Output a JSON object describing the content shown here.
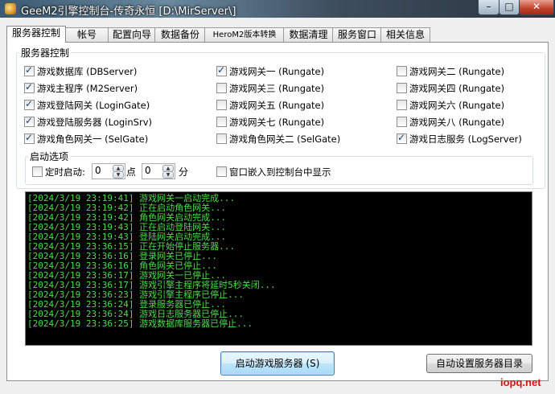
{
  "window": {
    "title": "GeeM2引擎控制台-传奇永恒 [D:\\MirServer\\]",
    "minimize": "–",
    "maximize": "□",
    "close": "✕"
  },
  "tabs": [
    "服务器控制",
    "帐号",
    "配置向导",
    "数据备份",
    "HeroM2版本转换",
    "数据清理",
    "服务窗口",
    "相关信息"
  ],
  "server_control": {
    "legend": "服务器控制",
    "items": [
      {
        "label": "游戏数据库 (DBServer)",
        "checked": true
      },
      {
        "label": "游戏网关一 (Rungate)",
        "checked": true
      },
      {
        "label": "游戏网关二 (Rungate)",
        "checked": false
      },
      {
        "label": "游戏主程序 (M2Server)",
        "checked": true
      },
      {
        "label": "游戏网关三 (Rungate)",
        "checked": false
      },
      {
        "label": "游戏网关四 (Rungate)",
        "checked": false
      },
      {
        "label": "游戏登陆网关 (LoginGate)",
        "checked": true
      },
      {
        "label": "游戏网关五 (Rungate)",
        "checked": false
      },
      {
        "label": "游戏网关六 (Rungate)",
        "checked": false
      },
      {
        "label": "游戏登陆服务器 (LoginSrv)",
        "checked": true
      },
      {
        "label": "游戏网关七 (Rungate)",
        "checked": false
      },
      {
        "label": "游戏网关八 (Rungate)",
        "checked": false
      },
      {
        "label": "游戏角色网关一 (SelGate)",
        "checked": true
      },
      {
        "label": "游戏角色网关二 (SelGate)",
        "checked": false
      },
      {
        "label": "游戏日志服务 (LogServer)",
        "checked": true
      }
    ]
  },
  "startup": {
    "legend": "启动选项",
    "timer_label": "定时启动:",
    "timer_checked": false,
    "hour_value": "0",
    "hour_unit": "点",
    "minute_value": "0",
    "minute_unit": "分",
    "embed_label": "窗口嵌入到控制台中显示",
    "embed_checked": false
  },
  "log": [
    "[2024/3/19 23:19:41] 游戏网关一启动完成...",
    "[2024/3/19 23:19:42] 正在启动角色网关...",
    "[2024/3/19 23:19:42] 角色网关启动完成...",
    "[2024/3/19 23:19:43] 正在启动登陆网关...",
    "[2024/3/19 23:19:43] 登陆网关启动完成...",
    "[2024/3/19 23:36:15] 正在开始停止服务器...",
    "[2024/3/19 23:36:16] 登录网关已停止...",
    "[2024/3/19 23:36:16] 角色网关已停止...",
    "[2024/3/19 23:36:17] 游戏网关一已停止...",
    "[2024/3/19 23:36:17] 游戏引擎主程序将延时5秒关闭...",
    "[2024/3/19 23:36:23] 游戏引擎主程序已停止...",
    "[2024/3/19 23:36:24] 登录服务器已停止...",
    "[2024/3/19 23:36:24] 游戏日志服务器已停止...",
    "[2024/3/19 23:36:25] 游戏数据库服务器已停止..."
  ],
  "buttons": {
    "start": "启动游戏服务器 (S)",
    "auto_dir": "自动设置服务器目录"
  },
  "watermark": "iopq.net",
  "colors": {
    "log_text": "#4ddc4d",
    "log_bg": "#000000",
    "watermark": "#e01010"
  }
}
